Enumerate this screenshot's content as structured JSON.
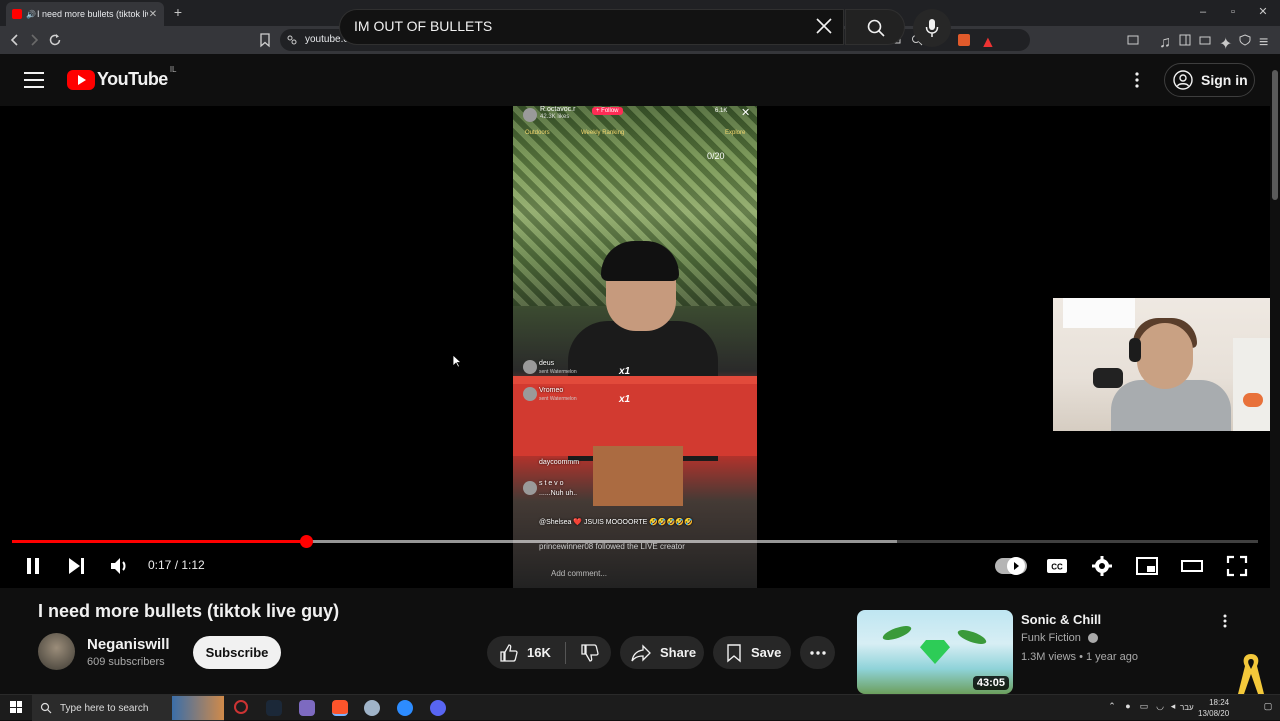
{
  "browser": {
    "tab_title": "I need more bullets (tiktok liv",
    "url": "youtube.com/watch?v=7q16jlOmxlM"
  },
  "youtube": {
    "logo_text": "YouTube",
    "country_code": "IL",
    "search_query": "IM OUT OF BULLETS",
    "sign_in_label": "Sign in"
  },
  "player": {
    "time_display": "0:17 / 1:12",
    "progress_fraction": 0.2357,
    "buffered_fraction": 0.71,
    "is_playing": true
  },
  "tiktok_overlay": {
    "creator_name": "R.octavoc.r",
    "likes": "42.3K likes",
    "follow_label": "+ Follow",
    "viewers": "6.1K",
    "categories": [
      "Outdoors",
      "Weekly Ranking",
      "Explore"
    ],
    "counter": "0/20",
    "chat": [
      {
        "user": "deus",
        "sub": "sent Watermelon",
        "gift": "x1"
      },
      {
        "user": "Vromeo",
        "sub": "sent Watermelon",
        "gift": "x1"
      },
      {
        "user": "daycoommm",
        "sub": ""
      },
      {
        "user": "s t e v o",
        "sub": "......Nuh uh.."
      },
      {
        "user": "@Shelsea ❤️ JSUIS MOOOORTE 🤣🤣🤣🤣🤣",
        "sub": ""
      }
    ],
    "followed_text": "princewinner08 followed the LIVE creator",
    "comment_placeholder": "Add comment..."
  },
  "video": {
    "title": "I need more bullets (tiktok live guy)",
    "channel_name": "Neganiswill",
    "subscribers": "609 subscribers",
    "subscribe_label": "Subscribe",
    "likes": "16K",
    "share_label": "Share",
    "save_label": "Save"
  },
  "recommended": {
    "title": "Sonic & Chill",
    "channel": "Funk Fiction",
    "meta": "1.3M views • 1 year ago",
    "duration": "43:05"
  },
  "taskbar": {
    "search_placeholder": "Type here to search",
    "language": "עבר",
    "time": "18:24",
    "date": "13/08/20"
  },
  "colors": {
    "youtube_red": "#ff0000",
    "background": "#0f0f0f",
    "pill_bg": "#272727"
  }
}
